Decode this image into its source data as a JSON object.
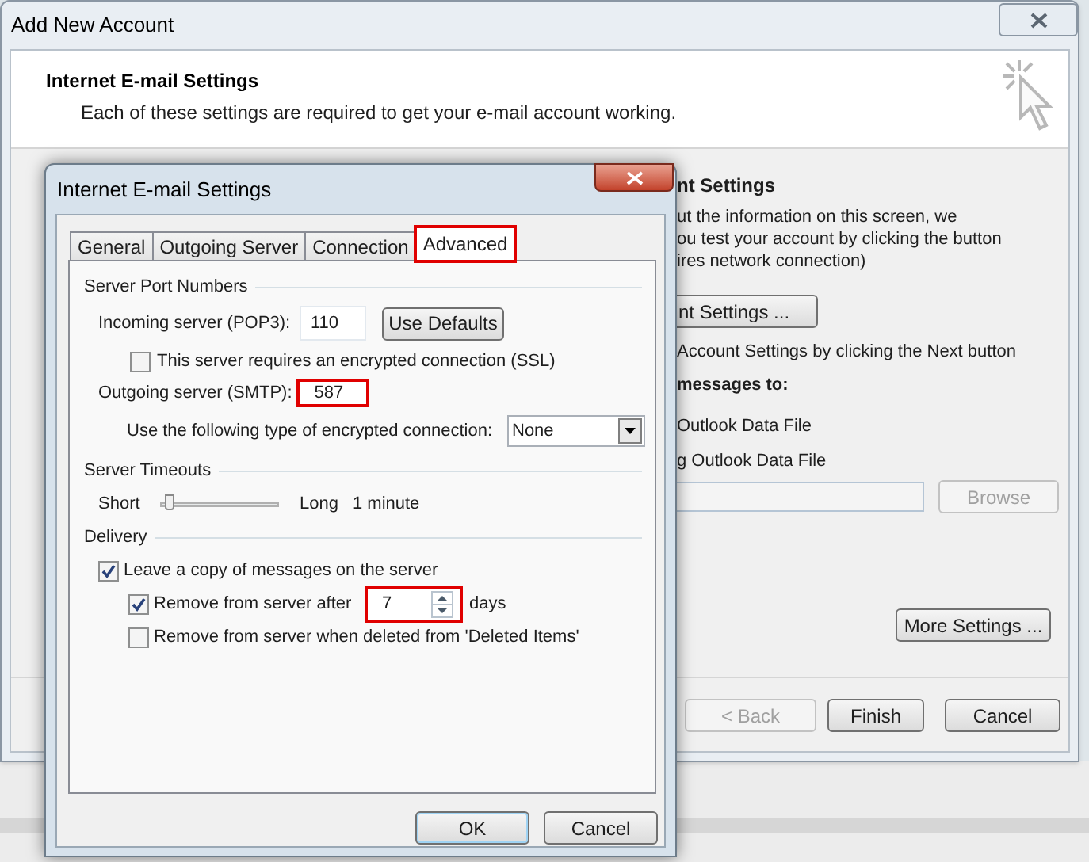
{
  "background_window": {
    "title": "Add New Account",
    "header": {
      "title": "Internet E-mail Settings",
      "subtitle": "Each of these settings are required to get your e-mail account working."
    },
    "right_section": {
      "heading": "nt Settings",
      "lines": [
        "ut the information on this screen, we",
        "ou test your account by clicking the button",
        "ires network connection)"
      ],
      "test_button": "nt Settings ...",
      "next_note": "Account Settings by clicking the Next button",
      "deliver_heading": "messages to:",
      "options": [
        "Outlook Data File",
        "g Outlook Data File"
      ],
      "browse_button": {
        "label": "Browse",
        "disabled": true
      },
      "more_settings_button": "More Settings ..."
    },
    "buttons": [
      {
        "label": "< Back",
        "disabled": true
      },
      {
        "label": "Finish",
        "disabled": false
      },
      {
        "label": "Cancel",
        "disabled": false
      }
    ]
  },
  "dialog": {
    "title": "Internet E-mail Settings",
    "tabs": [
      {
        "label": "General",
        "selected": false,
        "highlighted": false
      },
      {
        "label": "Outgoing Server",
        "selected": false,
        "highlighted": false
      },
      {
        "label": "Connection",
        "selected": false,
        "highlighted": false
      },
      {
        "label": "Advanced",
        "selected": true,
        "highlighted": true
      }
    ],
    "ports": {
      "heading": "Server Port Numbers",
      "incoming_label": "Incoming server (POP3):",
      "incoming_value": "110",
      "use_defaults_button": "Use Defaults",
      "ssl": {
        "label": "This server requires an encrypted connection (SSL)",
        "checked": false
      },
      "outgoing_label": "Outgoing server (SMTP):",
      "outgoing": {
        "value": "587",
        "highlighted": true
      },
      "encryption_label": "Use the following type of encrypted connection:",
      "encryption_value": "None"
    },
    "timeouts": {
      "heading": "Server Timeouts",
      "short_label": "Short",
      "long_label": "Long",
      "level": 0.05,
      "reading": "1 minute"
    },
    "delivery": {
      "heading": "Delivery",
      "leave_copy": {
        "label": "Leave a copy of messages on the server",
        "checked": true
      },
      "remove_after": {
        "label": "Remove from server after",
        "checked": true,
        "value": "7",
        "unit": "days",
        "highlighted": true
      },
      "remove_deleted": {
        "label": "Remove from server when deleted from 'Deleted Items'",
        "checked": false
      }
    },
    "buttons": [
      {
        "label": "OK",
        "default": true
      },
      {
        "label": "Cancel",
        "default": false
      }
    ]
  }
}
